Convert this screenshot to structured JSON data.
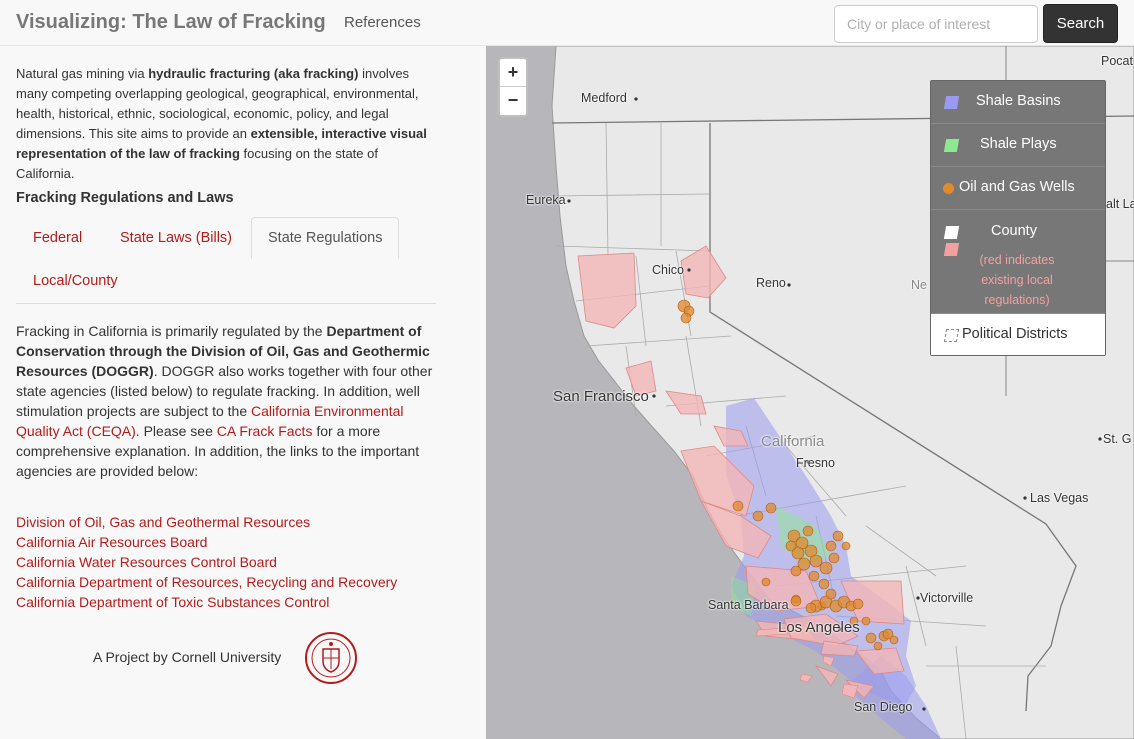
{
  "navbar": {
    "brand": "Visualizing: The Law of Fracking",
    "references_link": "References",
    "search_placeholder": "City or place of interest",
    "search_button": "Search"
  },
  "sidebar": {
    "intro": {
      "p1": "Natural gas mining via ",
      "b1": "hydraulic fracturing (aka fracking)",
      "p2": " involves many competing overlapping geological, geographical, environmental, health, historical, ethnic, sociological, economic, policy, and legal dimensions. This site aims to provide an ",
      "b2": "extensible, interactive visual representation of the law of fracking",
      "p3": " focusing on the state of California."
    },
    "section_title": "Fracking Regulations and Laws",
    "tabs": [
      {
        "label": "Federal"
      },
      {
        "label": "State Laws (Bills)"
      },
      {
        "label": "State Regulations"
      },
      {
        "label": "Local/County"
      }
    ],
    "active_tab": "State Regulations",
    "body": {
      "t1": "Fracking in California is primarily regulated by the ",
      "b1": "Department of Conservation through the Division of Oil, Gas and Geothermic Resources (DOGGR)",
      "t2": ". DOGGR also works together with four other state agencies (listed below) to regulate fracking. In addition, well stimulation projects are subject to the ",
      "link1": "California Environmental Quality Act (CEQA).",
      "t3": " Please see ",
      "link2": "CA Frack Facts",
      "t4": " for a more comprehensive explanation. In addition, the links to the important agencies are provided below:"
    },
    "agency_links": [
      "Division of Oil, Gas and Geothermal Resources",
      "California Air Resources Board",
      "California Water Resources Control Board",
      "California Department of Resources, Recycling and Recovery",
      "California Department of Toxic Substances Control"
    ],
    "credit": "A Project by Cornell University"
  },
  "map": {
    "zoom_in": "+",
    "zoom_out": "−",
    "cities": {
      "medford": "Medford",
      "eureka": "Eureka",
      "chico": "Chico",
      "reno": "Reno",
      "sanfrancisco": "San Francisco",
      "california": "California",
      "fresno": "Fresno",
      "lasvegas": "Las Vegas",
      "santabarbara": "Santa Barbara",
      "losangeles": "Los Angeles",
      "victorville": "Victorville",
      "sandiego": "San Diego",
      "pocat": "Pocat",
      "saltla": "alt La",
      "ne": "Ne",
      "stge": "St. G"
    },
    "legend": {
      "shale_basins": "Shale Basins",
      "shale_plays": "Shale Plays",
      "wells": "Oil and Gas Wells",
      "county": "County",
      "county_note": "(red indicates existing local regulations)",
      "political": "Political Districts"
    },
    "colors": {
      "accent": "#b31b1b",
      "shale_basin": "#9a9af0",
      "shale_play": "#8ee88e",
      "well": "#e08a2c",
      "county_reg": "#f3b5b5",
      "land": "#e9e9e9",
      "water": "#b7b7bb"
    }
  }
}
